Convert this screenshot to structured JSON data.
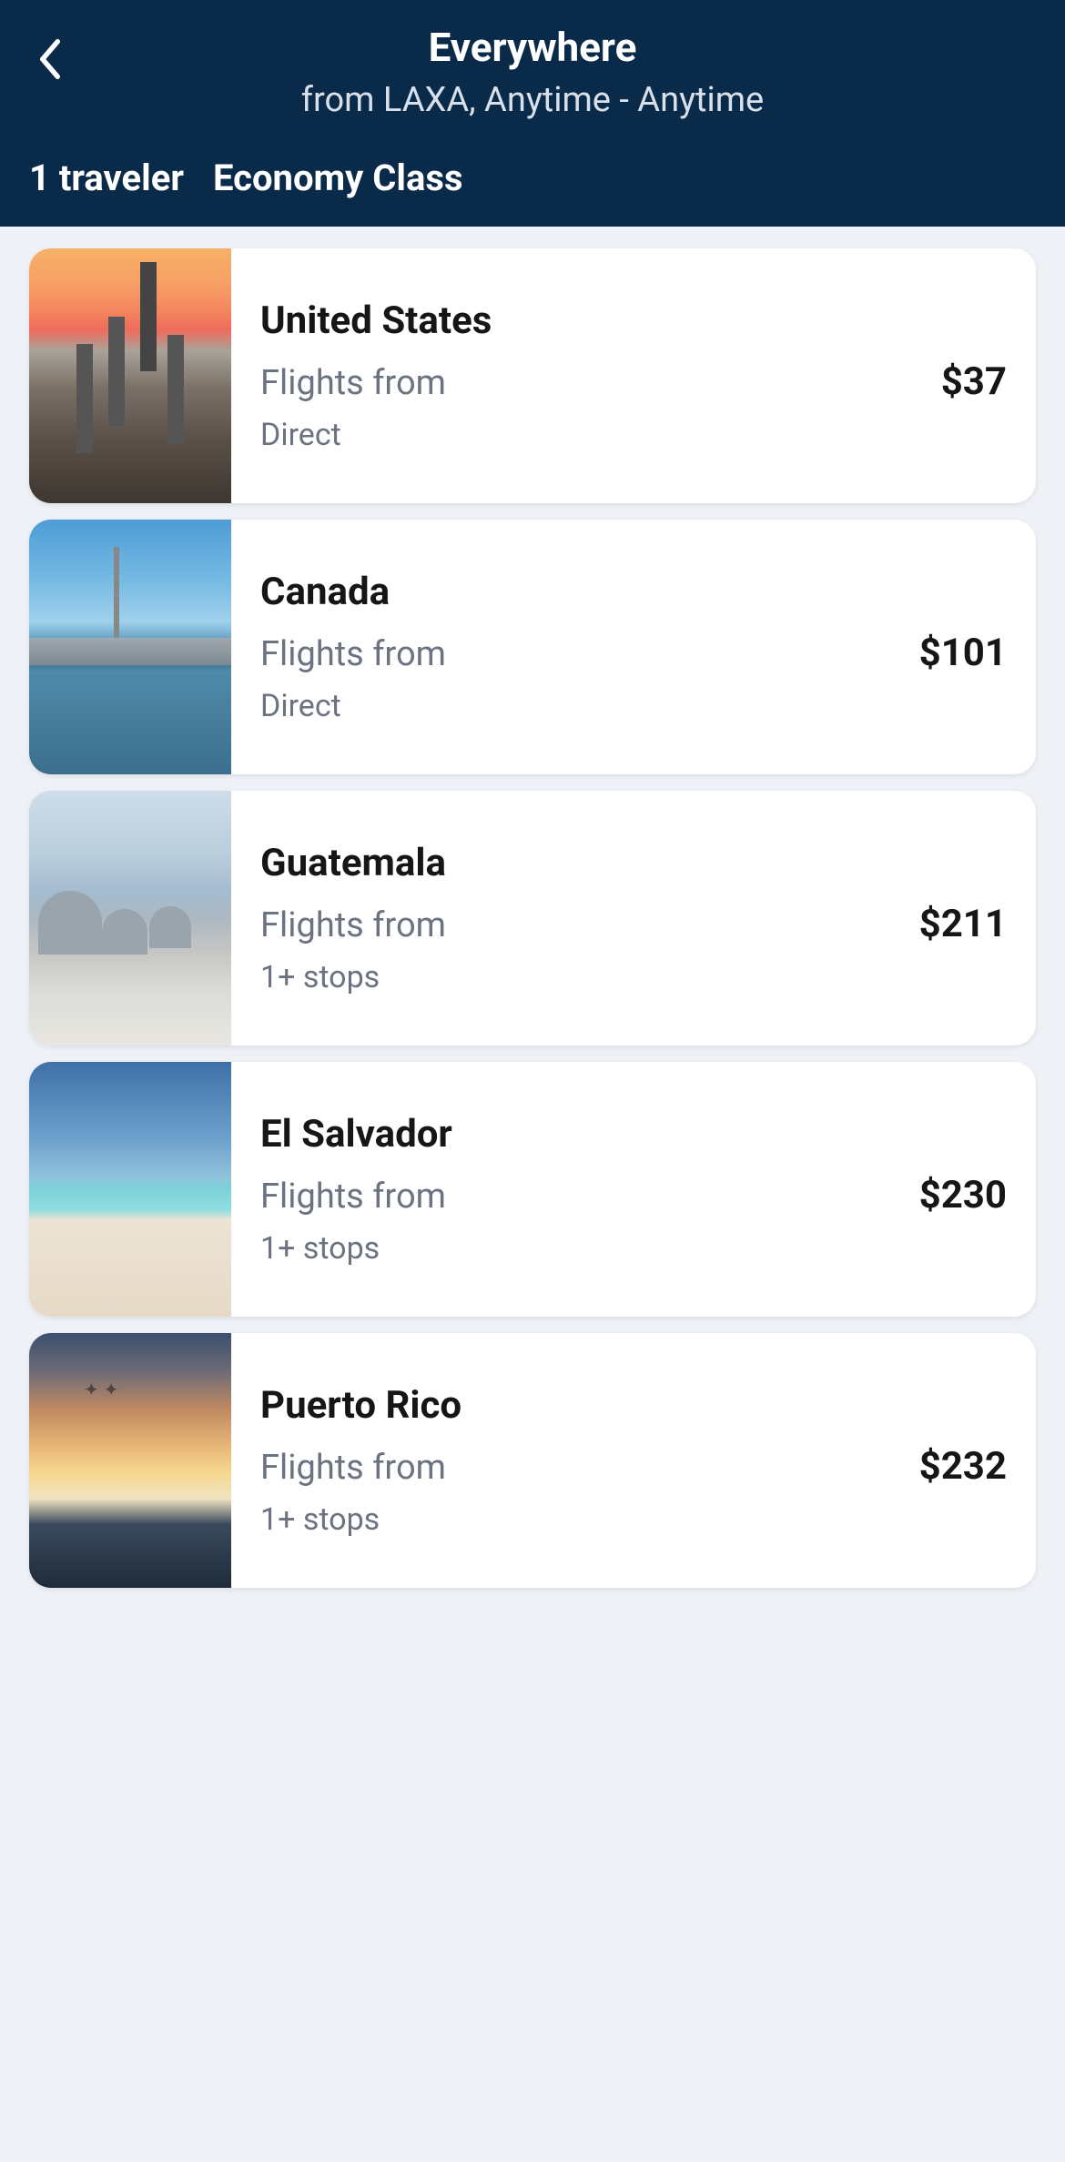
{
  "header": {
    "title": "Everywhere",
    "subtitle": "from LAXA, Anytime - Anytime",
    "travelers": "1 traveler",
    "cabin": "Economy Class"
  },
  "labels": {
    "flights_from": "Flights from"
  },
  "results": [
    {
      "name": "United States",
      "price": "$37",
      "stops": "Direct",
      "thumb": "thumb-us"
    },
    {
      "name": "Canada",
      "price": "$101",
      "stops": "Direct",
      "thumb": "thumb-ca"
    },
    {
      "name": "Guatemala",
      "price": "$211",
      "stops": "1+ stops",
      "thumb": "thumb-gt"
    },
    {
      "name": "El Salvador",
      "price": "$230",
      "stops": "1+ stops",
      "thumb": "thumb-sv"
    },
    {
      "name": "Puerto Rico",
      "price": "$232",
      "stops": "1+ stops",
      "thumb": "thumb-pr"
    }
  ]
}
